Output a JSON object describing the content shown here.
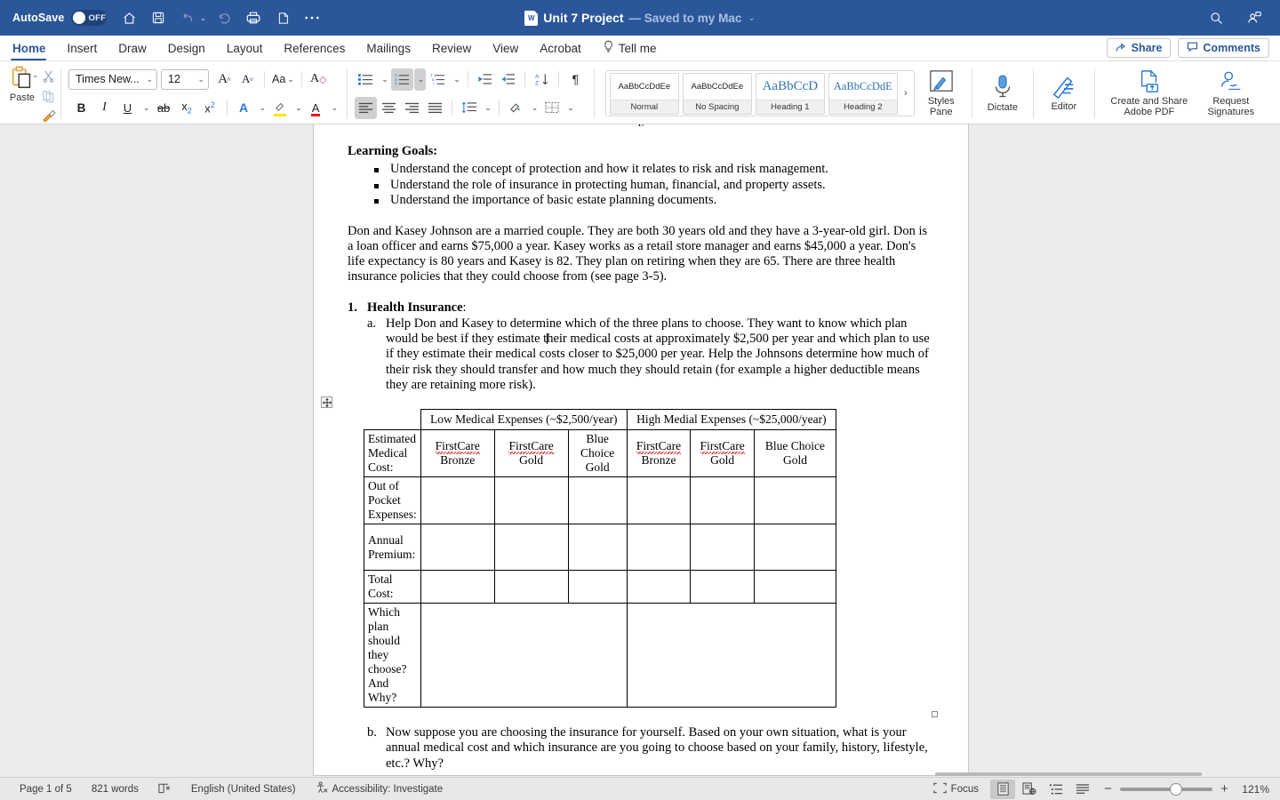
{
  "titlebar": {
    "autosave_label": "AutoSave",
    "autosave_state": "OFF",
    "doc_title": "Unit 7 Project",
    "save_state": "— Saved to my Mac",
    "icons": [
      "home-icon",
      "save-icon",
      "undo-icon",
      "redo-icon",
      "print-icon",
      "new-doc-icon",
      "more-icon"
    ],
    "right_icons": [
      "search-icon",
      "collaborate-icon"
    ],
    "accent_color": "#2b579a"
  },
  "tabs": [
    {
      "label": "Home",
      "active": true
    },
    {
      "label": "Insert",
      "active": false
    },
    {
      "label": "Draw",
      "active": false
    },
    {
      "label": "Design",
      "active": false
    },
    {
      "label": "Layout",
      "active": false
    },
    {
      "label": "References",
      "active": false
    },
    {
      "label": "Mailings",
      "active": false
    },
    {
      "label": "Review",
      "active": false
    },
    {
      "label": "View",
      "active": false
    },
    {
      "label": "Acrobat",
      "active": false
    }
  ],
  "tellme": "Tell me",
  "share_label": "Share",
  "comments_label": "Comments",
  "ribbon": {
    "paste_label": "Paste",
    "font_name": "Times New...",
    "font_size": "12",
    "grow_font": "A",
    "shrink_font": "A",
    "change_case": "Aa",
    "clear_format": "A",
    "bold": "B",
    "italic": "I",
    "underline": "U",
    "strikethrough": "ab",
    "subscript": "x",
    "superscript": "x",
    "text_effects": "A",
    "highlight": "A",
    "font_color": "A",
    "styles": [
      {
        "preview": "AaBbCcDdEe",
        "name": "Normal",
        "kind": "normal"
      },
      {
        "preview": "AaBbCcDdEe",
        "name": "No Spacing",
        "kind": "normal"
      },
      {
        "preview": "AaBbCcD",
        "name": "Heading 1",
        "kind": "h1"
      },
      {
        "preview": "AaBbCcDdE",
        "name": "Heading 2",
        "kind": "h2"
      }
    ],
    "gallery_more": "›",
    "styles_pane": "Styles\nPane",
    "styles_pane_l1": "Styles",
    "styles_pane_l2": "Pane",
    "dictate": "Dictate",
    "editor": "Editor",
    "adobe_l1": "Create and Share",
    "adobe_l2": "Adobe PDF",
    "signatures_l1": "Request",
    "signatures_l2": "Signatures"
  },
  "document": {
    "cutoff_text": "y",
    "learning_goals_heading": "Learning Goals:",
    "goals": [
      "Understand the concept of protection and how it relates to risk and risk management.",
      "Understand the role of insurance in protecting human, financial, and property assets.",
      "Understand the importance of basic estate planning documents."
    ],
    "scenario": "Don and Kasey Johnson are a married couple.  They are both 30 years old and they have a 3-year-old girl.  Don is a loan officer and earns $75,000 a year. Kasey works as a retail store manager and earns $45,000 a year. Don's life expectancy is 80 years and Kasey is 82.  They plan on retiring when they are 65. There are three health insurance policies that they could choose from (see page 3-5).",
    "item1_marker": "1.",
    "item1_title": "Health Insurance",
    "item1_colon": ":",
    "item1a_marker": "a.",
    "item1a_text_part1": "Help Don and Kasey to determine which of the three plans to choose.    They want to know which plan would be best if they estimate t",
    "item1a_text_part2": "heir medical costs at approximately $2,500 per year and which plan to use if they estimate their medical costs closer to $25,000 per year.  Help the Johnsons determine how much of their risk they should transfer and how much they should retain (for example a higher deductible means they are retaining more risk).",
    "item1b_marker": "b.",
    "item1b_text": "Now suppose you are choosing the insurance for yourself. Based on your own situation, what is your annual medical cost and which insurance are you going to choose based on your family, history, lifestyle, etc.?  Why?",
    "table": {
      "group_headers": [
        "Low Medical Expenses (~$2,500/year)",
        "High Medial Expenses (~$25,000/year)"
      ],
      "row_header_label": "Estimated Medical Cost:",
      "column_headers": [
        {
          "l1": "FirstCare",
          "l2": "Bronze",
          "misspelled": true
        },
        {
          "l1": "FirstCare",
          "l2": "Gold",
          "misspelled": true
        },
        {
          "l1": "Blue",
          "l2": "Choice",
          "l3": "Gold",
          "misspelled": false
        },
        {
          "l1": "FirstCare",
          "l2": "Bronze",
          "misspelled": true
        },
        {
          "l1": "FirstCare",
          "l2": "Gold",
          "misspelled": true
        },
        {
          "l1": "Blue Choice",
          "l2": "Gold",
          "misspelled": false
        }
      ],
      "rows": [
        {
          "label": "Out of Pocket Expenses:",
          "cells": [
            "",
            "",
            "",
            "",
            "",
            ""
          ]
        },
        {
          "label": "Annual Premium:",
          "cells": [
            "",
            "",
            "",
            "",
            "",
            ""
          ]
        },
        {
          "label": "Total Cost:",
          "cells": [
            "",
            "",
            "",
            "",
            "",
            ""
          ]
        },
        {
          "label": "Which plan should they choose? And Why?",
          "cells": [
            "",
            ""
          ],
          "merged": true
        }
      ]
    }
  },
  "statusbar": {
    "page": "Page 1 of 5",
    "words": "821 words",
    "proofing_icon": "proofing-icon",
    "language": "English (United States)",
    "accessibility": "Accessibility: Investigate",
    "focus": "Focus",
    "views": [
      "print-layout-view",
      "web-layout-view",
      "outline-view",
      "draft-view"
    ],
    "zoom_out": "−",
    "zoom_in": "+",
    "zoom_level": "121%"
  }
}
